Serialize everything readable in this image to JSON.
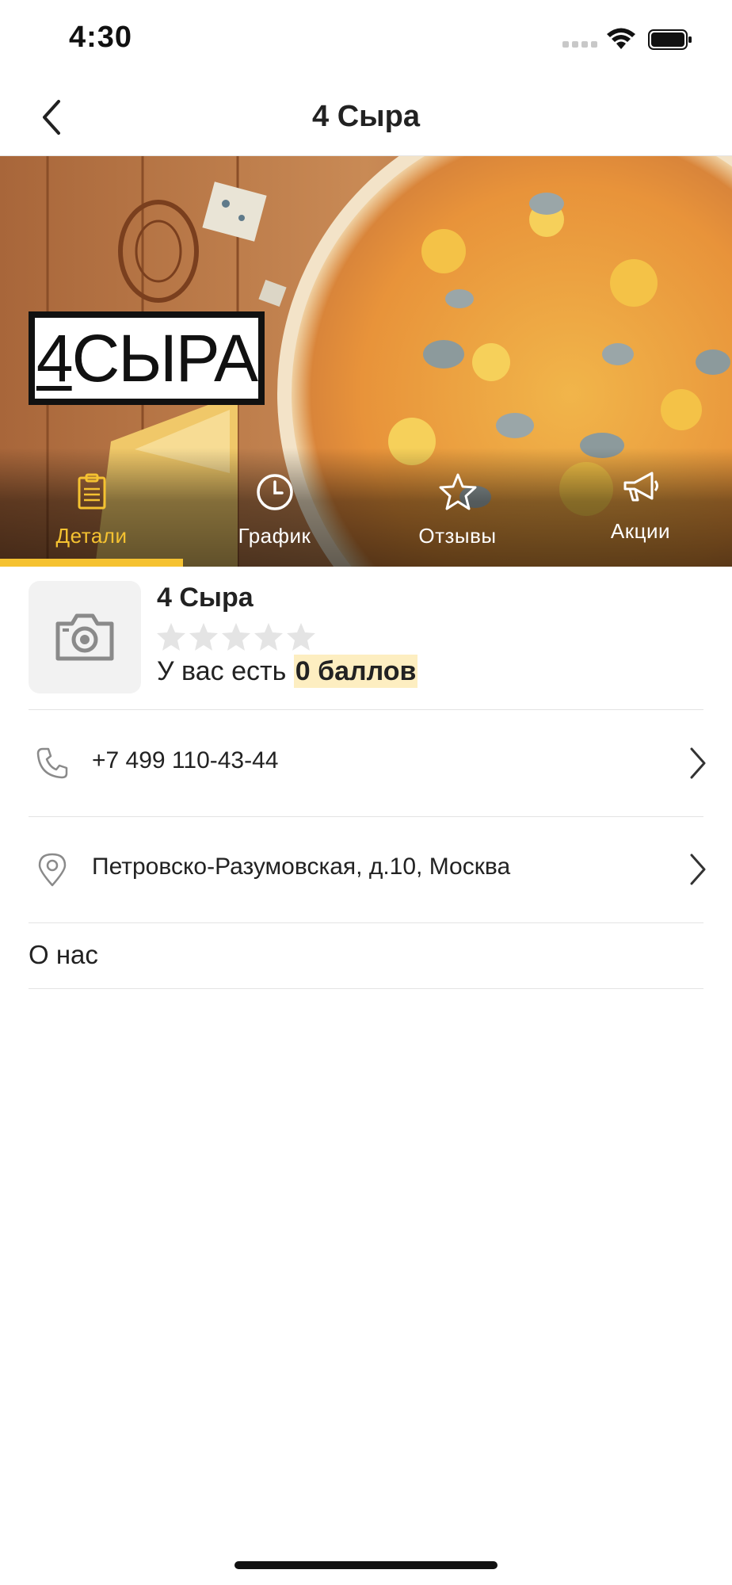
{
  "status_bar": {
    "time": "4:30",
    "icons": [
      "cellular-signal-icon",
      "wifi-icon",
      "battery-icon"
    ]
  },
  "nav": {
    "back_icon": "chevron-left-icon",
    "title": "4 Сыра"
  },
  "hero": {
    "logo_text_prefix": "4",
    "logo_text_suffix": "СЫРА",
    "tabs": [
      {
        "label": "Детали",
        "icon": "clipboard-icon",
        "active": true
      },
      {
        "label": "График",
        "icon": "clock-icon",
        "active": false
      },
      {
        "label": "Отзывы",
        "icon": "star-icon",
        "active": false
      },
      {
        "label": "Акции",
        "icon": "megaphone-icon",
        "active": false
      }
    ]
  },
  "venue": {
    "avatar_icon": "camera-icon",
    "name": "4 Сыра",
    "rating": 0,
    "rating_max": 5,
    "points_prefix": "У вас есть",
    "points_value": "0 баллов"
  },
  "contacts": {
    "phone": "+7 499 110-43-44",
    "address": "Петровско-Разумовская, д.10, Москва"
  },
  "about": {
    "label": "О нас"
  },
  "colors": {
    "accent": "#f5c231",
    "points_highlight": "#fdeec1",
    "icon_gray": "#8a8a8a",
    "star_empty": "#e4e4e4"
  }
}
